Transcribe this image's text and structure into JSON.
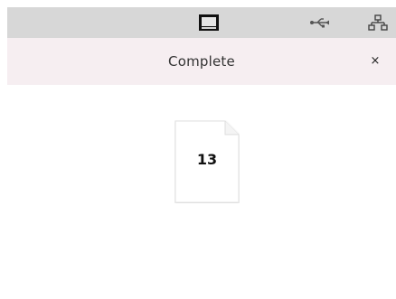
{
  "toolbar": {
    "icons": [
      "window-icon",
      "usb-icon",
      "network-icon"
    ],
    "background": "#d7d7d7"
  },
  "dialog": {
    "title": "Complete",
    "close_label": "×",
    "header_background": "#f6eef1"
  },
  "file": {
    "count": "13",
    "icon": "document-icon"
  }
}
